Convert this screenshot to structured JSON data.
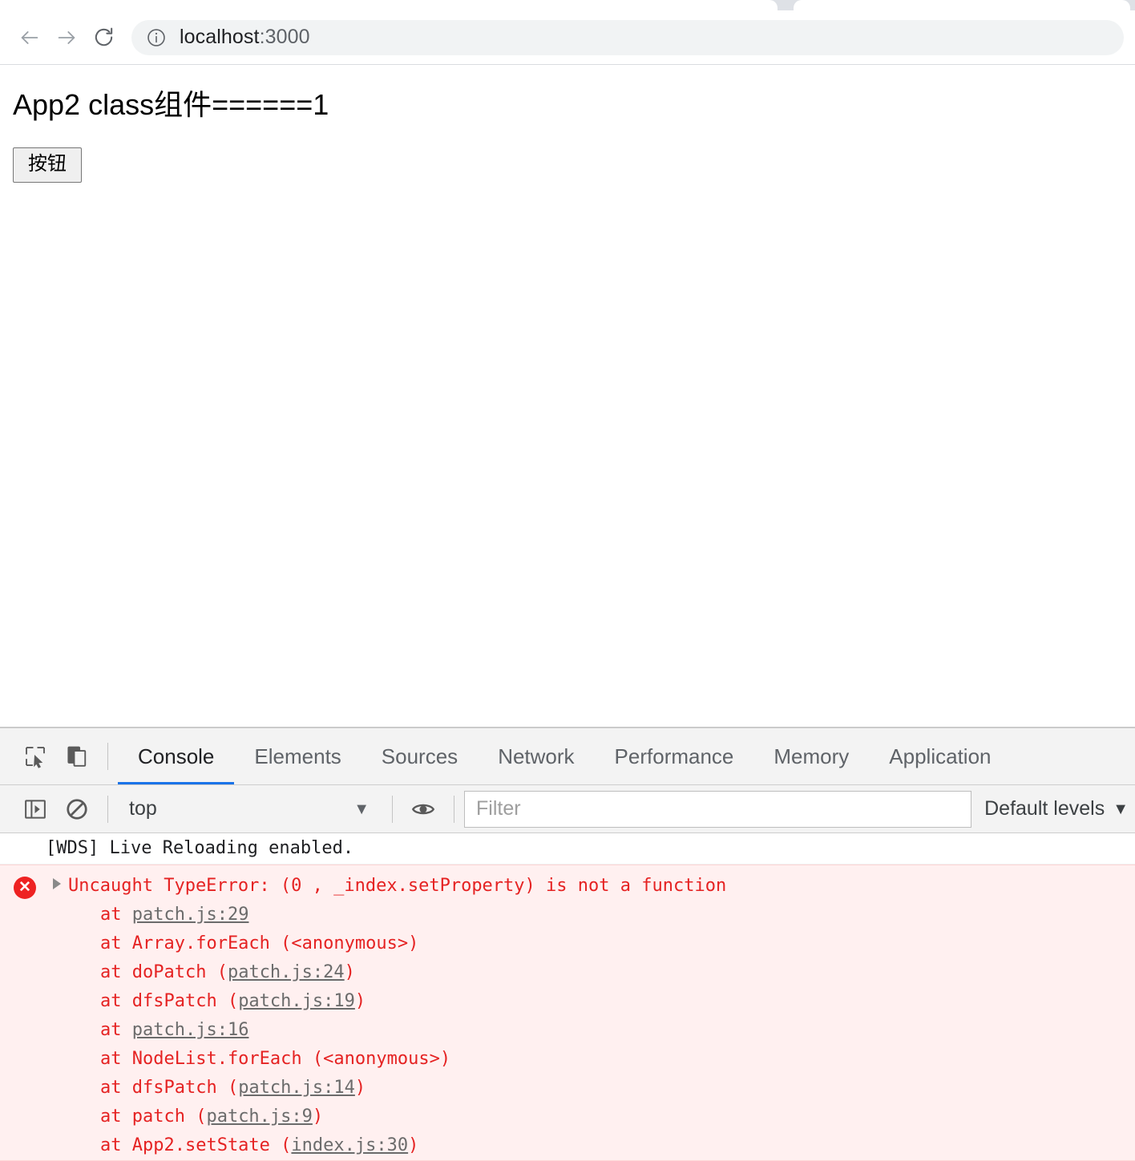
{
  "browser": {
    "back_label": "Back",
    "forward_label": "Forward",
    "reload_label": "Reload",
    "site_info_label": "View site information",
    "url_host": "localhost",
    "url_port": ":3000",
    "url_full": "localhost:3000"
  },
  "page": {
    "heading": "App2 class组件======1",
    "button_label": "按钮"
  },
  "devtools": {
    "inspect_icon_label": "Inspect element",
    "device_toolbar_icon_label": "Toggle device toolbar",
    "tabs": [
      {
        "label": "Console",
        "active": true
      },
      {
        "label": "Elements",
        "active": false
      },
      {
        "label": "Sources",
        "active": false
      },
      {
        "label": "Network",
        "active": false
      },
      {
        "label": "Performance",
        "active": false
      },
      {
        "label": "Memory",
        "active": false
      },
      {
        "label": "Application",
        "active": false
      }
    ],
    "toolbar": {
      "sidebar_toggle_label": "Show console sidebar",
      "clear_console_label": "Clear console",
      "context_value": "top",
      "context_caret": "▼",
      "live_expression_label": "Create live expression",
      "filter_placeholder": "Filter",
      "filter_value": "",
      "levels_label": "Default levels",
      "levels_caret": "▼"
    },
    "console": {
      "messages": [
        {
          "level": "log",
          "text": "[WDS] Live Reloading enabled."
        }
      ],
      "error": {
        "icon_glyph": "✕",
        "title": "Uncaught TypeError: (0 , _index.setProperty) is not a function",
        "stack": [
          {
            "prefix": "at ",
            "fn": "",
            "open": "",
            "link": "patch.js:29",
            "close": ""
          },
          {
            "prefix": "at ",
            "fn": "Array.forEach ",
            "open": "(<anonymous>)",
            "link": "",
            "close": ""
          },
          {
            "prefix": "at ",
            "fn": "doPatch ",
            "open": "(",
            "link": "patch.js:24",
            "close": ")"
          },
          {
            "prefix": "at ",
            "fn": "dfsPatch ",
            "open": "(",
            "link": "patch.js:19",
            "close": ")"
          },
          {
            "prefix": "at ",
            "fn": "",
            "open": "",
            "link": "patch.js:16",
            "close": ""
          },
          {
            "prefix": "at ",
            "fn": "NodeList.forEach ",
            "open": "(<anonymous>)",
            "link": "",
            "close": ""
          },
          {
            "prefix": "at ",
            "fn": "dfsPatch ",
            "open": "(",
            "link": "patch.js:14",
            "close": ")"
          },
          {
            "prefix": "at ",
            "fn": "patch ",
            "open": "(",
            "link": "patch.js:9",
            "close": ")"
          },
          {
            "prefix": "at ",
            "fn": "App2.setState ",
            "open": "(",
            "link": "index.js:30",
            "close": ")"
          }
        ]
      }
    }
  },
  "colors": {
    "accent": "#1a73e8",
    "error": "#e52222",
    "error_bg": "#fff0f0",
    "chrome_bg": "#dee1e6",
    "devtools_bg": "#f3f3f3"
  }
}
